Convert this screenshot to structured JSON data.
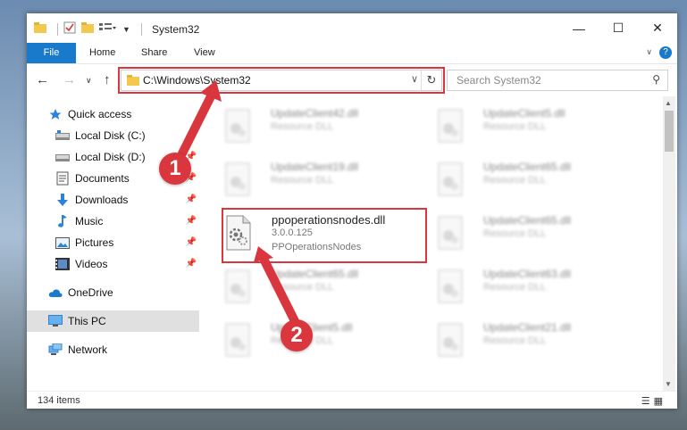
{
  "window": {
    "title": "System32"
  },
  "ribbon": {
    "tabs": [
      "File",
      "Home",
      "Share",
      "View"
    ]
  },
  "nav": {
    "path": "C:\\Windows\\System32",
    "search_placeholder": "Search System32"
  },
  "sidebar": {
    "items": [
      {
        "label": "Quick access",
        "icon": "star-icon"
      },
      {
        "label": "Local Disk (C:)",
        "icon": "drive-icon"
      },
      {
        "label": "Local Disk (D:)",
        "icon": "drive-icon"
      },
      {
        "label": "Documents",
        "icon": "documents-icon"
      },
      {
        "label": "Downloads",
        "icon": "download-icon"
      },
      {
        "label": "Music",
        "icon": "music-icon"
      },
      {
        "label": "Pictures",
        "icon": "pictures-icon"
      },
      {
        "label": "Videos",
        "icon": "videos-icon"
      },
      {
        "label": "OneDrive",
        "icon": "cloud-icon"
      },
      {
        "label": "This PC",
        "icon": "computer-icon"
      },
      {
        "label": "Network",
        "icon": "network-icon"
      }
    ]
  },
  "files": [
    {
      "name": "UpdateClient42.dll",
      "desc": "Resource DLL"
    },
    {
      "name": "UpdateClient5.dll",
      "desc": "Resource DLL"
    },
    {
      "name": "UpdateClient19.dll",
      "desc": "Resource DLL"
    },
    {
      "name": "UpdateClient65.dll",
      "desc": "Resource DLL"
    },
    {
      "name": "UpdateClient65.dll",
      "desc": "Resource DLL"
    },
    {
      "name": "UpdateClient63.dll",
      "desc": "Resource DLL"
    },
    {
      "name": "UpdateClient65.dll",
      "desc": "Resource DLL"
    },
    {
      "name": "UpdateClient5.dll",
      "desc": "Resource DLL"
    },
    {
      "name": "UpdateClient21.dll",
      "desc": "Resource DLL"
    }
  ],
  "highlighted_file": {
    "name": "ppoperationsnodes.dll",
    "version": "3.0.0.125",
    "description": "PPOperationsNodes"
  },
  "status": {
    "count": "134 items"
  },
  "callouts": [
    "1",
    "2"
  ],
  "colors": {
    "accent": "#1979ca",
    "highlight": "#d9363e"
  }
}
